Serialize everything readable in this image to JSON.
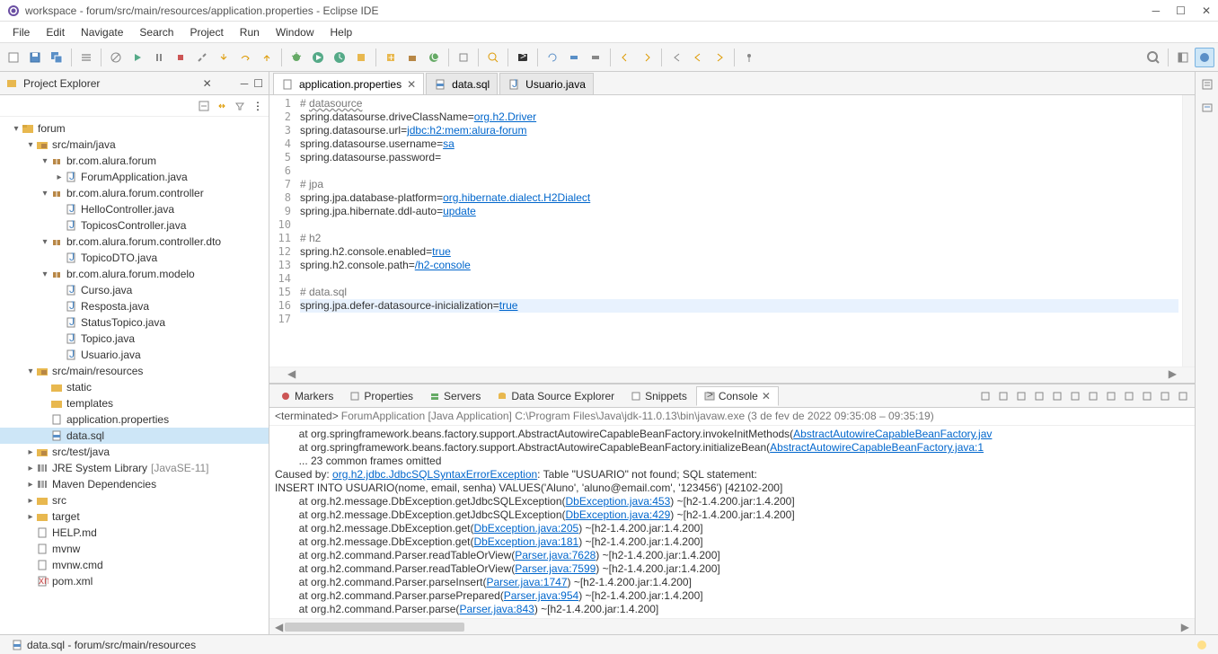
{
  "window": {
    "title": "workspace - forum/src/main/resources/application.properties - Eclipse IDE"
  },
  "menubar": [
    "File",
    "Edit",
    "Navigate",
    "Search",
    "Project",
    "Run",
    "Window",
    "Help"
  ],
  "project_explorer": {
    "title": "Project Explorer",
    "tree": [
      {
        "depth": 0,
        "arrow": "▾",
        "icon": "project",
        "label": "forum"
      },
      {
        "depth": 1,
        "arrow": "▾",
        "icon": "srcfolder",
        "label": "src/main/java"
      },
      {
        "depth": 2,
        "arrow": "▾",
        "icon": "package",
        "label": "br.com.alura.forum"
      },
      {
        "depth": 3,
        "arrow": "▸",
        "icon": "java",
        "label": "ForumApplication.java"
      },
      {
        "depth": 2,
        "arrow": "▾",
        "icon": "package",
        "label": "br.com.alura.forum.controller"
      },
      {
        "depth": 3,
        "arrow": "",
        "icon": "java",
        "label": "HelloController.java"
      },
      {
        "depth": 3,
        "arrow": "",
        "icon": "java",
        "label": "TopicosController.java"
      },
      {
        "depth": 2,
        "arrow": "▾",
        "icon": "package",
        "label": "br.com.alura.forum.controller.dto"
      },
      {
        "depth": 3,
        "arrow": "",
        "icon": "java",
        "label": "TopicoDTO.java"
      },
      {
        "depth": 2,
        "arrow": "▾",
        "icon": "package",
        "label": "br.com.alura.forum.modelo"
      },
      {
        "depth": 3,
        "arrow": "",
        "icon": "java",
        "label": "Curso.java"
      },
      {
        "depth": 3,
        "arrow": "",
        "icon": "java",
        "label": "Resposta.java"
      },
      {
        "depth": 3,
        "arrow": "",
        "icon": "java",
        "label": "StatusTopico.java"
      },
      {
        "depth": 3,
        "arrow": "",
        "icon": "java",
        "label": "Topico.java"
      },
      {
        "depth": 3,
        "arrow": "",
        "icon": "java",
        "label": "Usuario.java"
      },
      {
        "depth": 1,
        "arrow": "▾",
        "icon": "srcfolder",
        "label": "src/main/resources"
      },
      {
        "depth": 2,
        "arrow": "",
        "icon": "folder",
        "label": "static"
      },
      {
        "depth": 2,
        "arrow": "",
        "icon": "folder",
        "label": "templates"
      },
      {
        "depth": 2,
        "arrow": "",
        "icon": "file",
        "label": "application.properties"
      },
      {
        "depth": 2,
        "arrow": "",
        "icon": "sql",
        "label": "data.sql",
        "selected": true
      },
      {
        "depth": 1,
        "arrow": "▸",
        "icon": "srcfolder",
        "label": "src/test/java"
      },
      {
        "depth": 1,
        "arrow": "▸",
        "icon": "library",
        "label": "JRE System Library",
        "decoration": "[JavaSE-11]"
      },
      {
        "depth": 1,
        "arrow": "▸",
        "icon": "library",
        "label": "Maven Dependencies"
      },
      {
        "depth": 1,
        "arrow": "▸",
        "icon": "folder",
        "label": "src"
      },
      {
        "depth": 1,
        "arrow": "▸",
        "icon": "folder",
        "label": "target"
      },
      {
        "depth": 1,
        "arrow": "",
        "icon": "file",
        "label": "HELP.md"
      },
      {
        "depth": 1,
        "arrow": "",
        "icon": "file",
        "label": "mvnw"
      },
      {
        "depth": 1,
        "arrow": "",
        "icon": "file",
        "label": "mvnw.cmd"
      },
      {
        "depth": 1,
        "arrow": "",
        "icon": "xml",
        "label": "pom.xml"
      }
    ]
  },
  "editor_tabs": [
    {
      "label": "application.properties",
      "active": true,
      "closable": true,
      "icon": "file"
    },
    {
      "label": "data.sql",
      "active": false,
      "closable": false,
      "icon": "sql"
    },
    {
      "label": "Usuario.java",
      "active": false,
      "closable": false,
      "icon": "java"
    }
  ],
  "editor_lines": [
    {
      "n": 1,
      "type": "comment",
      "text": "# "
    },
    {
      "n": 2,
      "type": "kv",
      "key": "spring.datasourse.driveClassName",
      "val": "org.h2.Driver",
      "valtype": "link"
    },
    {
      "n": 3,
      "type": "kv",
      "key": "spring.datasourse.url",
      "val": "jdbc:h2:mem:alura-forum",
      "valtype": "link"
    },
    {
      "n": 4,
      "type": "kv",
      "key": "spring.datasourse.username",
      "val": "sa",
      "valtype": "link"
    },
    {
      "n": 5,
      "type": "kv",
      "key": "spring.datasourse.password",
      "val": "",
      "valtype": "plain"
    },
    {
      "n": 6,
      "type": "blank"
    },
    {
      "n": 7,
      "type": "comment",
      "text": "# jpa"
    },
    {
      "n": 8,
      "type": "kv",
      "key": "spring.jpa.database-platform",
      "val": "org.hibernate.dialect.H2Dialect",
      "valtype": "link"
    },
    {
      "n": 9,
      "type": "kv",
      "key": "spring.jpa.hibernate.ddl-auto",
      "val": "update",
      "valtype": "link"
    },
    {
      "n": 10,
      "type": "blank"
    },
    {
      "n": 11,
      "type": "comment",
      "text": "# h2"
    },
    {
      "n": 12,
      "type": "kv",
      "key": "spring.h2.console.enabled",
      "val": "true",
      "valtype": "link"
    },
    {
      "n": 13,
      "type": "kv",
      "key": "spring.h2.console.path",
      "val": "/h2-console",
      "valtype": "link"
    },
    {
      "n": 14,
      "type": "blank"
    },
    {
      "n": 15,
      "type": "comment",
      "text": "# data.sql"
    },
    {
      "n": 16,
      "type": "kv",
      "key": "spring.jpa.defer-datasource-inicialization",
      "val": "true",
      "valtype": "link",
      "highlighted": true
    },
    {
      "n": 17,
      "type": "blank"
    }
  ],
  "datasource_underline": "datasource",
  "bottom_tabs": [
    {
      "label": "Markers",
      "icon": "markers"
    },
    {
      "label": "Properties",
      "icon": "properties"
    },
    {
      "label": "Servers",
      "icon": "servers"
    },
    {
      "label": "Data Source Explorer",
      "icon": "datasource"
    },
    {
      "label": "Snippets",
      "icon": "snippets"
    },
    {
      "label": "Console",
      "icon": "console",
      "active": true,
      "closable": true
    }
  ],
  "console": {
    "header_prefix": "<terminated>",
    "header_main": "ForumApplication [Java Application] C:\\Program Files\\Java\\jdk-11.0.13\\bin\\javaw.exe",
    "header_time": "(3 de fev de 2022 09:35:08 – 09:35:19)",
    "lines": [
      {
        "text": "        at org.springframework.beans.factory.support.AbstractAutowireCapableBeanFactory.invokeInitMethods(",
        "link": "AbstractAutowireCapableBeanFactory.jav"
      },
      {
        "text": "        at org.springframework.beans.factory.support.AbstractAutowireCapableBeanFactory.initializeBean(",
        "link": "AbstractAutowireCapableBeanFactory.java:1"
      },
      {
        "text": "        ... 23 common frames omitted"
      },
      {
        "text": "Caused by: ",
        "link": "org.h2.jdbc.JdbcSQLSyntaxErrorException",
        "after": ": Table \"USUARIO\" not found; SQL statement:"
      },
      {
        "text": "INSERT INTO USUARIO(nome, email, senha) VALUES('Aluno', 'aluno@email.com', '123456') [42102-200]"
      },
      {
        "text": "        at org.h2.message.DbException.getJdbcSQLException(",
        "link": "DbException.java:453",
        "after": ") ~[h2-1.4.200.jar:1.4.200]"
      },
      {
        "text": "        at org.h2.message.DbException.getJdbcSQLException(",
        "link": "DbException.java:429",
        "after": ") ~[h2-1.4.200.jar:1.4.200]"
      },
      {
        "text": "        at org.h2.message.DbException.get(",
        "link": "DbException.java:205",
        "after": ") ~[h2-1.4.200.jar:1.4.200]"
      },
      {
        "text": "        at org.h2.message.DbException.get(",
        "link": "DbException.java:181",
        "after": ") ~[h2-1.4.200.jar:1.4.200]"
      },
      {
        "text": "        at org.h2.command.Parser.readTableOrView(",
        "link": "Parser.java:7628",
        "after": ") ~[h2-1.4.200.jar:1.4.200]"
      },
      {
        "text": "        at org.h2.command.Parser.readTableOrView(",
        "link": "Parser.java:7599",
        "after": ") ~[h2-1.4.200.jar:1.4.200]"
      },
      {
        "text": "        at org.h2.command.Parser.parseInsert(",
        "link": "Parser.java:1747",
        "after": ") ~[h2-1.4.200.jar:1.4.200]"
      },
      {
        "text": "        at org.h2.command.Parser.parsePrepared(",
        "link": "Parser.java:954",
        "after": ") ~[h2-1.4.200.jar:1.4.200]"
      },
      {
        "text": "        at org.h2.command.Parser.parse(",
        "link": "Parser.java:843",
        "after": ") ~[h2-1.4.200.jar:1.4.200]"
      }
    ]
  },
  "statusbar": {
    "item": "data.sql - forum/src/main/resources"
  }
}
